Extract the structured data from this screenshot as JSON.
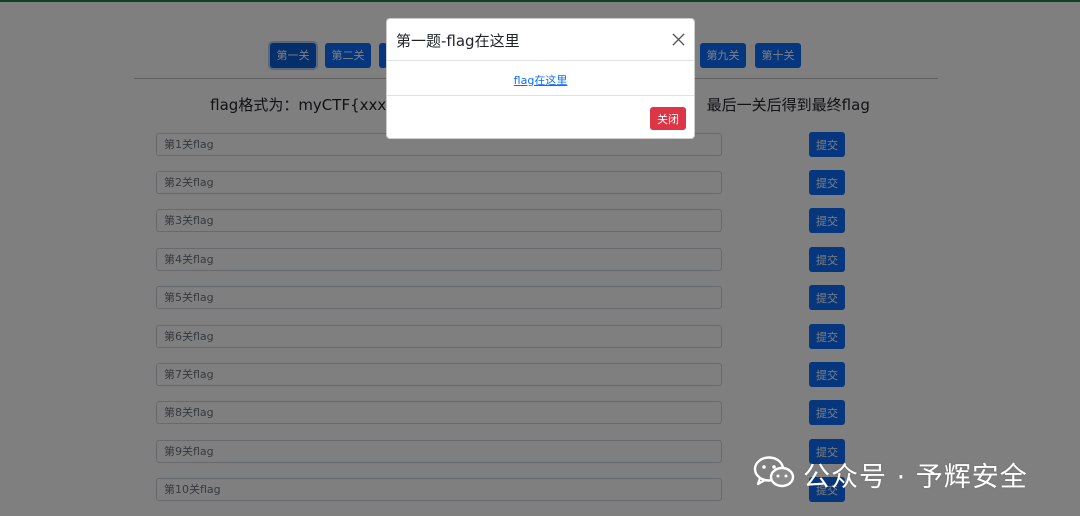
{
  "colors": {
    "primary": "#0d6efd",
    "danger": "#dc3545",
    "success_line": "#198754",
    "backdrop": "rgba(0,0,0,0.5)"
  },
  "nav": {
    "visible_buttons": [
      {
        "label": "第一关",
        "active": true
      },
      {
        "label": "第二关",
        "active": false
      },
      {
        "label": "",
        "active": false
      },
      {
        "label": "第九关",
        "active": false
      },
      {
        "label": "第十关",
        "active": false
      }
    ]
  },
  "instruction": {
    "left_text": "flag格式为：myCTF{xxxx}",
    "right_text": "最后一关后得到最终flag"
  },
  "form": {
    "submit_label": "提交",
    "rows": [
      {
        "placeholder": "第1关flag"
      },
      {
        "placeholder": "第2关flag"
      },
      {
        "placeholder": "第3关flag"
      },
      {
        "placeholder": "第4关flag"
      },
      {
        "placeholder": "第5关flag"
      },
      {
        "placeholder": "第6关flag"
      },
      {
        "placeholder": "第7关flag"
      },
      {
        "placeholder": "第8关flag"
      },
      {
        "placeholder": "第9关flag"
      },
      {
        "placeholder": "第10关flag"
      }
    ]
  },
  "modal": {
    "title": "第一题-flag在这里",
    "link_text": "flag在这里",
    "close_label": "关闭",
    "close_icon": "close-icon"
  },
  "watermark": {
    "text": "公众号 · 予辉安全",
    "icon": "wechat-icon"
  }
}
